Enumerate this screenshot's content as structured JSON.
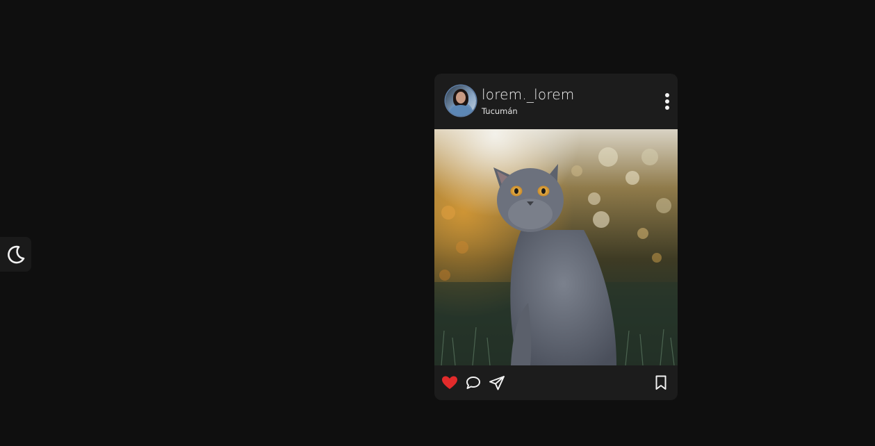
{
  "theme_toggle": {
    "icon": "moon-icon"
  },
  "post": {
    "username": "lorem._lorem",
    "location": "Tucumán",
    "avatar_icon": "user-avatar",
    "menu_icon": "more-vertical-icon",
    "image_subject": "grey-cat-photo",
    "actions": {
      "like_icon": "heart-icon",
      "like_color": "#e22b2b",
      "liked": true,
      "comment_icon": "comment-icon",
      "share_icon": "send-icon",
      "save_icon": "bookmark-icon"
    }
  },
  "colors": {
    "background": "#0f0f0f",
    "card": "#1c1c1c",
    "text": "#f2f2f2"
  }
}
